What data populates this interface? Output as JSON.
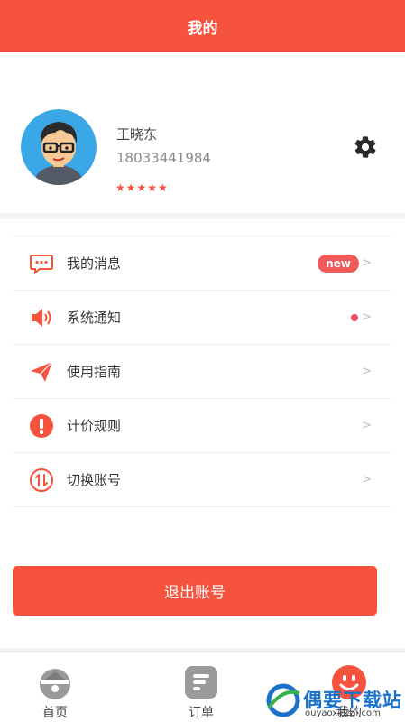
{
  "header": {
    "title": "我的"
  },
  "profile": {
    "name": "王晓东",
    "phone": "18033441984",
    "stars": "★★★★★",
    "star_count": 5
  },
  "menu": {
    "items": [
      {
        "label": "我的消息",
        "icon": "message-icon",
        "badge": "new",
        "chevron": ">"
      },
      {
        "label": "系统通知",
        "icon": "speaker-icon",
        "dot": true,
        "chevron": ">"
      },
      {
        "label": "使用指南",
        "icon": "paper-plane-icon",
        "chevron": ">"
      },
      {
        "label": "计价规则",
        "icon": "exclamation-icon",
        "chevron": ">"
      },
      {
        "label": "切换账号",
        "icon": "switch-account-icon",
        "chevron": ">"
      }
    ]
  },
  "logout": {
    "label": "退出账号"
  },
  "tabbar": {
    "items": [
      {
        "label": "首页",
        "icon": "home-icon",
        "active": false
      },
      {
        "label": "订单",
        "icon": "order-icon",
        "active": false
      },
      {
        "label": "我的",
        "icon": "smiley-icon",
        "active": true
      }
    ]
  },
  "watermark": {
    "text": "偶要下载站",
    "sub": "ouyaoxiazai.com"
  },
  "colors": {
    "accent": "#f5533d",
    "badge": "#f05a5a",
    "watermark": "#1c72c9"
  }
}
